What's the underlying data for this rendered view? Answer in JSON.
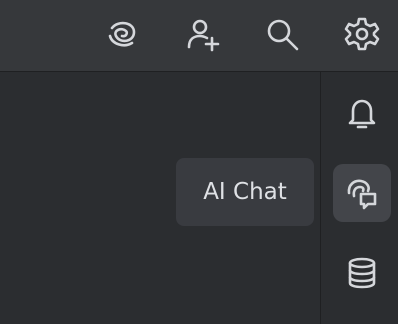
{
  "toolbar": {
    "icons": [
      "ai-assistant-icon",
      "add-user-icon",
      "search-icon",
      "gear-icon"
    ]
  },
  "right_bar": {
    "icons": [
      "bell-icon",
      "ai-chat-icon",
      "database-icon"
    ],
    "active": "ai-chat-icon"
  },
  "tooltip": {
    "text": "AI Chat"
  },
  "colors": {
    "toolbar_bg": "#36383b",
    "panel_bg": "#2b2d30",
    "icon": "#d5d7db",
    "active_bg": "#43454a",
    "tooltip_bg": "#393b40"
  }
}
